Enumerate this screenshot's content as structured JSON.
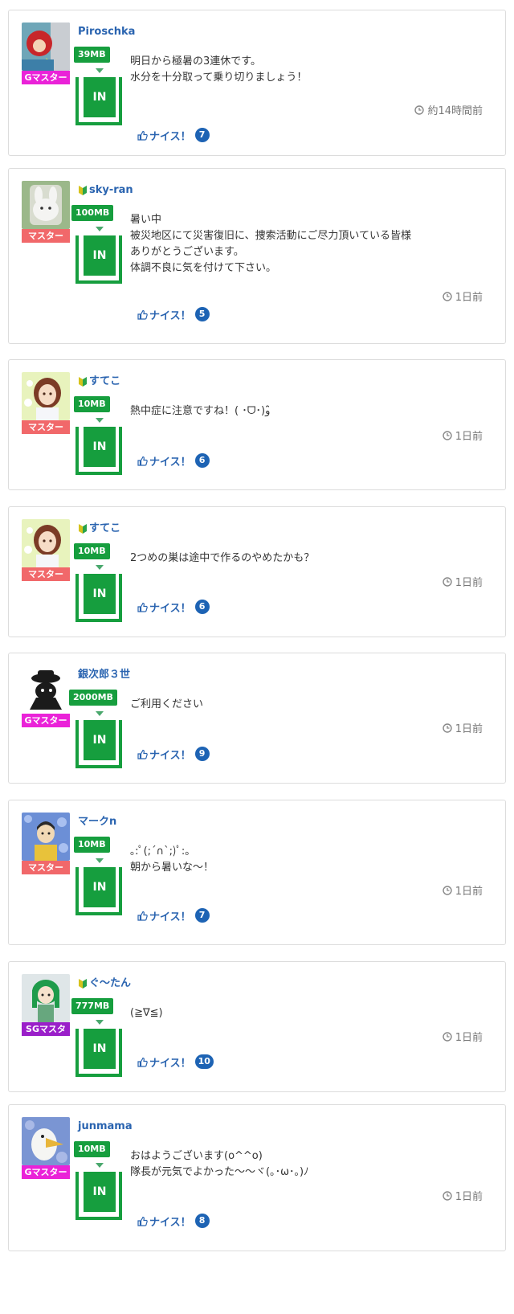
{
  "labels": {
    "nice": "ナイス！",
    "in_button": "IN"
  },
  "colors": {
    "username": "#2a64b0",
    "mb_badge": "#169e3e",
    "rank_g": "#ea22d8",
    "rank_master": "#f1686a",
    "rank_sg": "#9a1fc9",
    "nice_count": "#1d63b4"
  },
  "posts": [
    {
      "username": "Piroschka",
      "beginner": false,
      "rank": "Gマスター",
      "rank_type": "g",
      "avatar": "avatar-red-hood-icon",
      "mb": "39MB",
      "message": [
        "明日から極暑の3連休です。",
        "水分を十分取って乗り切りましょう！"
      ],
      "time": "約14時間前",
      "nice_count": "7"
    },
    {
      "username": "sky-ran",
      "beginner": true,
      "rank": "マスター",
      "rank_type": "m",
      "avatar": "avatar-white-rabbit-icon",
      "mb": "100MB",
      "message": [
        "暑い中",
        "被災地区にて災害復旧に、捜索活動にご尽力頂いている皆様",
        "ありがとうございます。",
        "体調不良に気を付けて下さい。"
      ],
      "time": "1日前",
      "nice_count": "5"
    },
    {
      "username": "すてこ",
      "beginner": true,
      "rank": "マスター",
      "rank_type": "m",
      "avatar": "avatar-girl-brown-hair-icon",
      "mb": "10MB",
      "message": [
        "熱中症に注意ですね！( ･ᗜ･)و ̑̑"
      ],
      "time": "1日前",
      "nice_count": "6"
    },
    {
      "username": "すてこ",
      "beginner": true,
      "rank": "マスター",
      "rank_type": "m",
      "avatar": "avatar-girl-brown-hair-icon",
      "mb": "10MB",
      "message": [
        "2つめの巣は途中で作るのやめたかも？"
      ],
      "time": "1日前",
      "nice_count": "6"
    },
    {
      "username": "銀次郎３世",
      "beginner": false,
      "rank": "Gマスター",
      "rank_type": "g",
      "avatar": "avatar-black-cat-hat-icon",
      "mb": "2000MB",
      "message": [
        "ご利用ください"
      ],
      "time": "1日前",
      "nice_count": "9"
    },
    {
      "username": "マークn",
      "beginner": false,
      "rank": "マスター",
      "rank_type": "m",
      "avatar": "avatar-man-flowers-icon",
      "mb": "10MB",
      "message": [
        "｡:ﾟ(;´∩`;)ﾟ:｡",
        "朝から暑いな〜！"
      ],
      "time": "1日前",
      "nice_count": "7"
    },
    {
      "username": "ぐ〜たん",
      "beginner": true,
      "rank": "SGマスタ",
      "rank_type": "sg",
      "avatar": "avatar-green-hair-girl-icon",
      "mb": "777MB",
      "message": [
        "(≧∇≦)"
      ],
      "time": "1日前",
      "nice_count": "10"
    },
    {
      "username": "junmama",
      "beginner": false,
      "rank": "Gマスター",
      "rank_type": "g",
      "avatar": "avatar-white-duck-icon",
      "mb": "10MB",
      "message": [
        "おはようございます(o^^o)",
        "隊長が元気でよかった〜〜ヾ(｡･ω･｡)ﾉ"
      ],
      "time": "1日前",
      "nice_count": "8"
    }
  ]
}
